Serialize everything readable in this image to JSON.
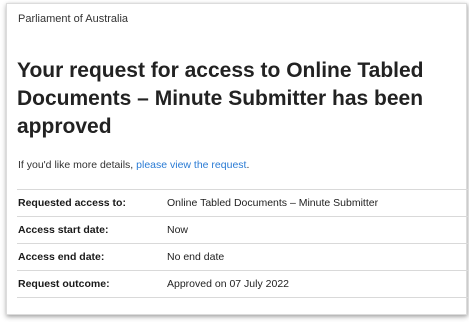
{
  "header": {
    "organisation": "Parliament of Australia"
  },
  "title": "Your request for access to Online Tabled Documents – Minute Submitter has been approved",
  "details": {
    "prefix": "If you'd like more details, ",
    "link_text": "please view the request",
    "suffix": "."
  },
  "rows": [
    {
      "label": "Requested access to:",
      "value": "Online Tabled Documents – Minute Submitter"
    },
    {
      "label": "Access start date:",
      "value": "Now"
    },
    {
      "label": "Access end date:",
      "value": "No end date"
    },
    {
      "label": "Request outcome:",
      "value": "Approved on 07 July 2022"
    }
  ],
  "colors": {
    "link": "#2a7bd4",
    "text": "#222222"
  }
}
